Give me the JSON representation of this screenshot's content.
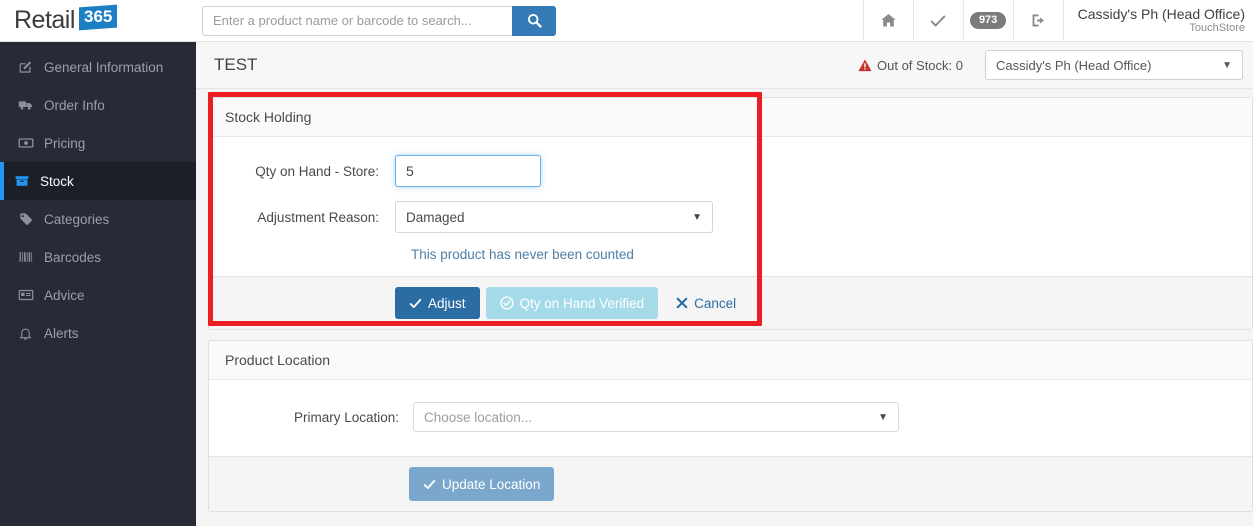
{
  "brand": {
    "name": "Retail",
    "badge": "365"
  },
  "search": {
    "placeholder": "Enter a product name or barcode to search...",
    "value": "",
    "button_icon": "search-icon"
  },
  "topbar": {
    "home_icon": "home-icon",
    "check_icon": "check-icon",
    "count_badge": "973",
    "logout_icon": "sign-out-icon",
    "user_name": "Cassidy's Ph (Head Office)",
    "user_sub": "TouchStore"
  },
  "sidebar": {
    "items": [
      {
        "label": "General Information",
        "icon": "edit-square-icon",
        "active": false
      },
      {
        "label": "Order Info",
        "icon": "truck-icon",
        "active": false
      },
      {
        "label": "Pricing",
        "icon": "money-bill-icon",
        "active": false
      },
      {
        "label": "Stock",
        "icon": "box-icon",
        "active": true
      },
      {
        "label": "Categories",
        "icon": "tag-icon",
        "active": false
      },
      {
        "label": "Barcodes",
        "icon": "barcode-icon",
        "active": false
      },
      {
        "label": "Advice",
        "icon": "id-card-icon",
        "active": false
      },
      {
        "label": "Alerts",
        "icon": "bell-icon",
        "active": false
      }
    ]
  },
  "page": {
    "title": "TEST",
    "out_of_stock_label": "Out of Stock: 0",
    "out_of_stock_icon": "warning-triangle-icon",
    "store_selected": "Cassidy's Ph (Head Office)"
  },
  "stock_holding": {
    "title": "Stock Holding",
    "qty_label": "Qty on Hand - Store:",
    "qty_value": "5",
    "reason_label": "Adjustment Reason:",
    "reason_selected": "Damaged",
    "note": "This product has never been counted",
    "adjust_label": "Adjust",
    "adjust_icon": "check-icon",
    "verify_label": "Qty on Hand Verified",
    "verify_icon": "check-circle-icon",
    "cancel_label": "Cancel",
    "cancel_icon": "close-icon"
  },
  "product_location": {
    "title": "Product Location",
    "primary_label": "Primary Location:",
    "primary_placeholder": "Choose location...",
    "update_label": "Update Location",
    "update_icon": "check-icon"
  },
  "colors": {
    "accent_blue": "#337ab7",
    "sidebar_bg": "#262b35",
    "active_blue": "#2196f3",
    "annotation_red": "#ee1c25",
    "verify_light_blue": "#a5dbe8",
    "danger_red": "#c9302c"
  }
}
